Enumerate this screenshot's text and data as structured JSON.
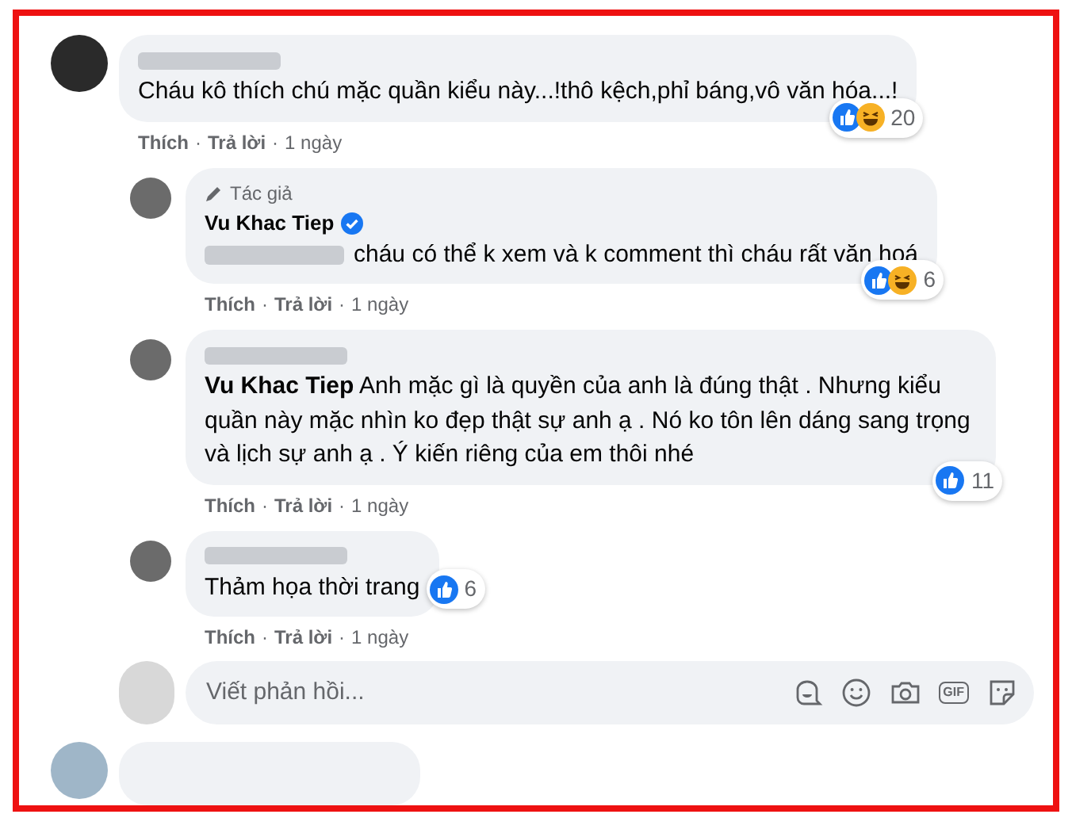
{
  "comments": [
    {
      "author_redacted": true,
      "text": "Cháu kô thích chú mặc quần kiểu này...!thô kệch,phỉ báng,vô văn hóa...!",
      "reactions": {
        "icons": [
          {
            "kind": "like"
          },
          {
            "kind": "haha"
          }
        ],
        "count": "20"
      },
      "actions": [
        "Thích",
        "Trả lời",
        "1 ngày"
      ],
      "separator": "·",
      "replies": [
        {
          "author_badge": "Tác giả",
          "author": "Vu Khac Tiep",
          "verified": true,
          "mention_redacted": true,
          "text": "cháu có thể k xem và k comment thì cháu rất văn hoá",
          "reactions": {
            "icons": [
              {
                "kind": "like"
              },
              {
                "kind": "haha"
              }
            ],
            "count": "6"
          },
          "actions": [
            "Thích",
            "Trả lời",
            "1 ngày"
          ],
          "separator": "·"
        },
        {
          "author_redacted": true,
          "text": "**Vu Khac Tiep** Anh mặc gì là quyền của anh là đúng thật . Nhưng kiểu quần này mặc nhìn ko đẹp thật sự anh ạ . Nó ko tôn lên dáng sang trọng và lịch sự anh ạ . Ý kiến riêng của em thôi nhé",
          "reactions": {
            "icons": [
              {
                "kind": "like"
              }
            ],
            "count": "11"
          },
          "actions": [
            "Thích",
            "Trả lời",
            "1 ngày"
          ],
          "separator": "·"
        },
        {
          "author_redacted": true,
          "text": "Thảm họa thời trang",
          "reactions": {
            "icons": [
              {
                "kind": "like"
              }
            ],
            "count": "6"
          },
          "actions": [
            "Thích",
            "Trả lời",
            "1 ngày"
          ],
          "separator": "·"
        }
      ],
      "reply_field": {
        "placeholder": "Viết phản hồi...",
        "gif_label": "GIF"
      }
    }
  ]
}
